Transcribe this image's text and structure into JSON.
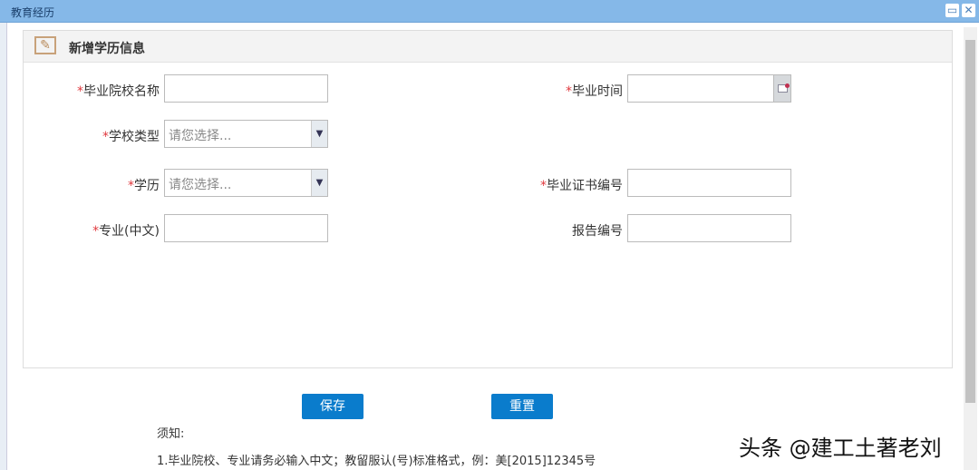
{
  "window": {
    "title": "教育经历"
  },
  "panel": {
    "title": "新增学历信息"
  },
  "form": {
    "school_name": {
      "label": "毕业院校名称",
      "value": ""
    },
    "grad_time": {
      "label": "毕业时间",
      "value": ""
    },
    "school_type": {
      "label": "学校类型",
      "placeholder": "请您选择..."
    },
    "degree": {
      "label": "学历",
      "placeholder": "请您选择..."
    },
    "cert_no": {
      "label": "毕业证书编号",
      "value": ""
    },
    "major": {
      "label": "专业(中文)",
      "value": ""
    },
    "report_no": {
      "label": "报告编号",
      "value": ""
    },
    "required_mark": "*"
  },
  "buttons": {
    "save": "保存",
    "reset": "重置"
  },
  "notes": {
    "heading": "须知:",
    "line1": "1.毕业院校、专业请务必输入中文；教留服认(号)标准格式，例：美[2015]12345号"
  },
  "watermark": "头条 @建工土著老刘"
}
